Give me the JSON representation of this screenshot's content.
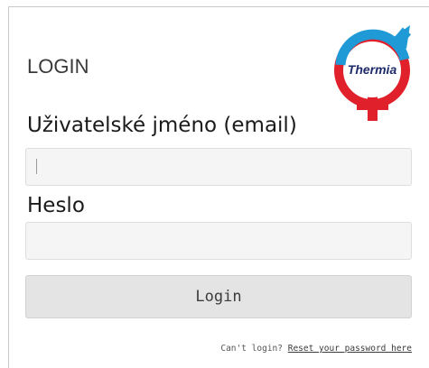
{
  "login": {
    "title": "LOGIN",
    "username_label": "Uživatelské jméno (email)",
    "username_value": "",
    "password_label": "Heslo",
    "password_value": "",
    "submit_label": "Login",
    "cant_login_text": "Can't login?",
    "reset_link": "Reset your password here"
  },
  "logo": {
    "text": "Thermia",
    "icon": "thermia-logo",
    "colors": {
      "blue": "#1f9ad6",
      "red": "#e0202b"
    }
  }
}
